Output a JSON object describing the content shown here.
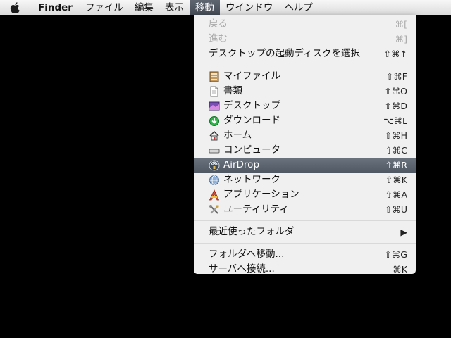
{
  "menubar": {
    "app_name": "Finder",
    "items": [
      "ファイル",
      "編集",
      "表示",
      "移動",
      "ウインドウ",
      "ヘルプ"
    ],
    "active_index": 3
  },
  "menu": {
    "group1": [
      {
        "label": "戻る",
        "shortcut": "⌘[",
        "disabled": true
      },
      {
        "label": "進む",
        "shortcut": "⌘]",
        "disabled": true
      },
      {
        "label": "デスクトップの起動ディスクを選択",
        "shortcut": "⇧⌘↑",
        "disabled": false
      }
    ],
    "group2": [
      {
        "label": "マイファイル",
        "shortcut": "⇧⌘F",
        "icon": "all-my-files-icon"
      },
      {
        "label": "書類",
        "shortcut": "⇧⌘O",
        "icon": "documents-icon"
      },
      {
        "label": "デスクトップ",
        "shortcut": "⇧⌘D",
        "icon": "desktop-icon"
      },
      {
        "label": "ダウンロード",
        "shortcut": "⌥⌘L",
        "icon": "downloads-icon"
      },
      {
        "label": "ホーム",
        "shortcut": "⇧⌘H",
        "icon": "home-icon"
      },
      {
        "label": "コンピュータ",
        "shortcut": "⇧⌘C",
        "icon": "computer-icon"
      },
      {
        "label": "AirDrop",
        "shortcut": "⇧⌘R",
        "icon": "airdrop-icon",
        "highlighted": true
      },
      {
        "label": "ネットワーク",
        "shortcut": "⇧⌘K",
        "icon": "network-icon"
      },
      {
        "label": "アプリケーション",
        "shortcut": "⇧⌘A",
        "icon": "applications-icon"
      },
      {
        "label": "ユーティリティ",
        "shortcut": "⇧⌘U",
        "icon": "utilities-icon"
      }
    ],
    "group3": [
      {
        "label": "最近使ったフォルダ",
        "submenu_arrow": "▶"
      }
    ],
    "group4": [
      {
        "label": "フォルダへ移動...",
        "shortcut": "⇧⌘G"
      },
      {
        "label": "サーバへ接続...",
        "shortcut": "⌘K"
      }
    ]
  },
  "colors": {
    "desktop": "#000000",
    "highlight": "#59626d",
    "disabled_text": "#a9a9a9"
  }
}
